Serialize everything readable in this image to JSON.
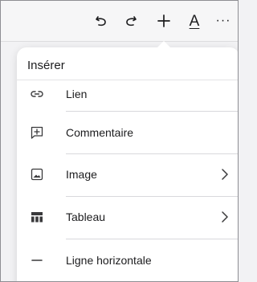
{
  "toolbar": {
    "undo_icon": "undo-icon",
    "redo_icon": "redo-icon",
    "insert_icon": "plus-icon",
    "text_format_label": "A",
    "more_label": "···"
  },
  "popover": {
    "title": "Insérer",
    "items": [
      {
        "label": "Lien",
        "icon": "link-icon",
        "has_submenu": false
      },
      {
        "label": "Commentaire",
        "icon": "comment-plus-icon",
        "has_submenu": false
      },
      {
        "label": "Image",
        "icon": "image-icon",
        "has_submenu": true
      },
      {
        "label": "Tableau",
        "icon": "table-icon",
        "has_submenu": true
      },
      {
        "label": "Ligne horizontale",
        "icon": "horizontal-line-icon",
        "has_submenu": false
      }
    ]
  },
  "colors": {
    "background": "#f2f2f4",
    "popover": "#ffffff",
    "text": "#1c1c1e",
    "separator": "#d8d8dc"
  }
}
